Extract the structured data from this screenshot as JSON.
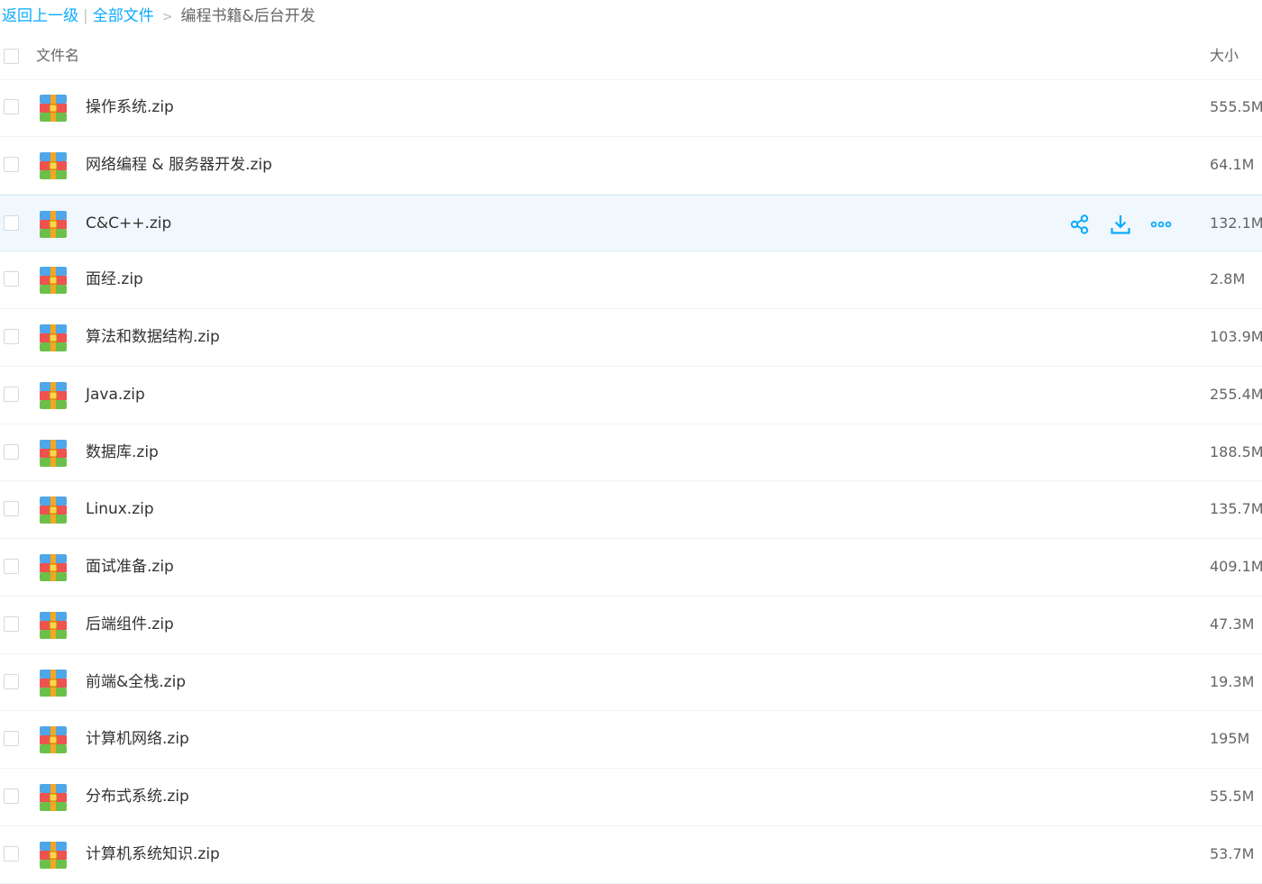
{
  "breadcrumb": {
    "back": "返回上一级",
    "separator": "|",
    "all_files": "全部文件",
    "arrow": ">",
    "current": "编程书籍&后台开发"
  },
  "header": {
    "name": "文件名",
    "size": "大小"
  },
  "colors": {
    "accent": "#09aaff",
    "hover_row": "#f1f8fd",
    "row_border": "#eef2f7"
  },
  "hovered_row_index": 2,
  "files": [
    {
      "name": "操作系统.zip",
      "size": "555.5M",
      "icon": "zip-archive-icon"
    },
    {
      "name": "网络编程 & 服务器开发.zip",
      "size": "64.1M",
      "icon": "zip-archive-icon"
    },
    {
      "name": "C&C++.zip",
      "size": "132.1M",
      "icon": "zip-archive-icon"
    },
    {
      "name": "面经.zip",
      "size": "2.8M",
      "icon": "zip-archive-icon"
    },
    {
      "name": "算法和数据结构.zip",
      "size": "103.9M",
      "icon": "zip-archive-icon"
    },
    {
      "name": "Java.zip",
      "size": "255.4M",
      "icon": "zip-archive-icon"
    },
    {
      "name": "数据库.zip",
      "size": "188.5M",
      "icon": "zip-archive-icon"
    },
    {
      "name": "Linux.zip",
      "size": "135.7M",
      "icon": "zip-archive-icon"
    },
    {
      "name": "面试准备.zip",
      "size": "409.1M",
      "icon": "zip-archive-icon"
    },
    {
      "name": "后端组件.zip",
      "size": "47.3M",
      "icon": "zip-archive-icon"
    },
    {
      "name": "前端&全栈.zip",
      "size": "19.3M",
      "icon": "zip-archive-icon"
    },
    {
      "name": "计算机网络.zip",
      "size": "195M",
      "icon": "zip-archive-icon"
    },
    {
      "name": "分布式系统.zip",
      "size": "55.5M",
      "icon": "zip-archive-icon"
    },
    {
      "name": "计算机系统知识.zip",
      "size": "53.7M",
      "icon": "zip-archive-icon"
    }
  ]
}
